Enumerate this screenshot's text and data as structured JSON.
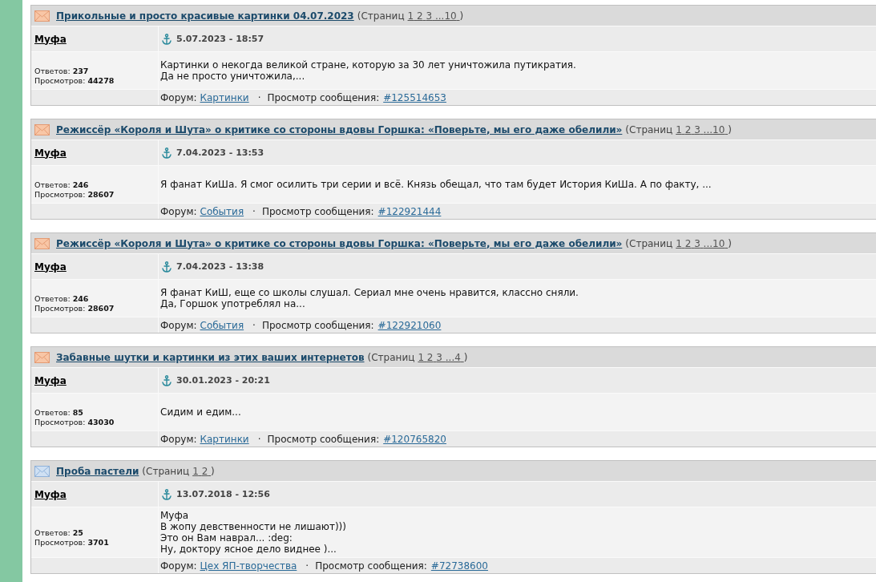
{
  "posts": [
    {
      "hot": true,
      "title": "Прикольные и просто красивые картинки 04.07.2023",
      "pages_label": "(Страниц",
      "pages": [
        "1",
        "2",
        "3",
        "...10"
      ],
      "pages_close": ")",
      "author": "Муфа",
      "date": "5.07.2023 - 18:57",
      "replies": "Ответов: **237**",
      "views": "Просмотров: **44278**",
      "message": "Картинки о некогда великой стране, которую за 30 лет уничтожила путикратия.\nДа не просто уничтожила,...",
      "forum_label": "Форум:",
      "forum": "Картинки",
      "separator": "·",
      "view_label": "Просмотр сообщения:",
      "post_link": "#125514653"
    },
    {
      "hot": true,
      "title": "Режиссёр «Короля и Шута» о критике со стороны вдовы Горшка: «Поверьте, мы его даже обелили»",
      "pages_label": "(Страниц",
      "pages": [
        "1",
        "2",
        "3",
        "...10"
      ],
      "pages_close": ")",
      "author": "Муфа",
      "date": "7.04.2023 - 13:53",
      "replies": "Ответов: **246**",
      "views": "Просмотров: **28607**",
      "message": "Я фанат КиШа. Я смог осилить три серии и всё. Князь обещал, что там будет История КиШа. А по факту, ...",
      "forum_label": "Форум:",
      "forum": "События",
      "separator": "·",
      "view_label": "Просмотр сообщения:",
      "post_link": "#122921444"
    },
    {
      "hot": true,
      "title": "Режиссёр «Короля и Шута» о критике со стороны вдовы Горшка: «Поверьте, мы его даже обелили»",
      "pages_label": "(Страниц",
      "pages": [
        "1",
        "2",
        "3",
        "...10"
      ],
      "pages_close": ")",
      "author": "Муфа",
      "date": "7.04.2023 - 13:38",
      "replies": "Ответов: **246**",
      "views": "Просмотров: **28607**",
      "message": "Я фанат КиШ, еще со школы слушал. Сериал мне очень нравится, классно сняли.\nДа, Горшок употреблял на...",
      "forum_label": "Форум:",
      "forum": "События",
      "separator": "·",
      "view_label": "Просмотр сообщения:",
      "post_link": "#122921060"
    },
    {
      "hot": true,
      "title": "Забавные шутки и картинки из этих ваших интернетов",
      "pages_label": "(Страниц",
      "pages": [
        "1",
        "2",
        "3",
        "...4"
      ],
      "pages_close": ")",
      "author": "Муфа",
      "date": "30.01.2023 - 20:21",
      "replies": "Ответов: **85**",
      "views": "Просмотров: **43030**",
      "message": "Сидим и едим...",
      "forum_label": "Форум:",
      "forum": "Картинки",
      "separator": "·",
      "view_label": "Просмотр сообщения:",
      "post_link": "#120765820"
    },
    {
      "hot": false,
      "title": "Проба пастели",
      "pages_label": "(Страниц",
      "pages": [
        "1",
        "2"
      ],
      "pages_close": ")",
      "author": "Муфа",
      "date": "13.07.2018 - 12:56",
      "replies": "Ответов: **25**",
      "views": "Просмотров: **3701**",
      "message": "Муфа\nВ жопу девственности не лишают)))\nЭто он Вам наврал... :deg:\nНу, доктору ясное дело виднее )...",
      "forum_label": "Форум:",
      "forum": "Цех ЯП-творчества",
      "separator": "·",
      "view_label": "Просмотр сообщения:",
      "post_link": "#72738600"
    }
  ]
}
